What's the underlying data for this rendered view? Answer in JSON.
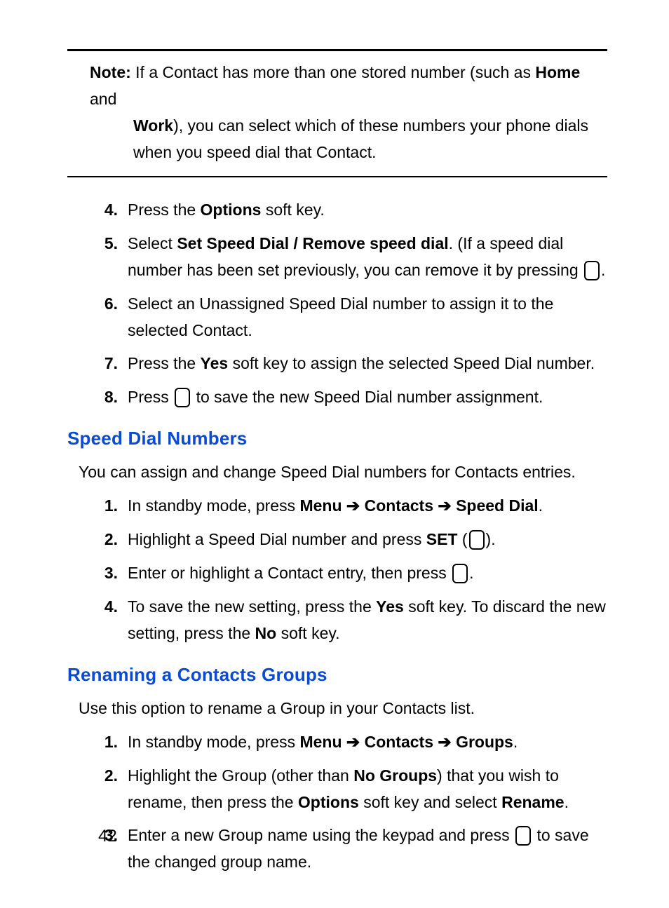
{
  "note": {
    "label": "Note:",
    "line1_pre": "If a Contact has more than one stored number (such as ",
    "home": "Home",
    "line1_mid": " and ",
    "work": "Work",
    "line2": "), you can select which of these numbers your phone dials when you speed dial that Contact."
  },
  "stepsA": [
    {
      "n": "4.",
      "pre": "Press the ",
      "b1": "Options",
      "post": " soft key."
    },
    {
      "n": "5.",
      "pre": "Select ",
      "b1": "Set Speed Dial / Remove speed dial",
      "mid": ". (If a speed dial number has been set previously, you can remove it by pressing ",
      "icon": true,
      "post": "."
    },
    {
      "n": "6.",
      "pre": "Select an Unassigned Speed Dial number to assign it to the selected Contact."
    },
    {
      "n": "7.",
      "pre": "Press the ",
      "b1": "Yes",
      "post": " soft key to assign the selected Speed Dial number."
    },
    {
      "n": "8.",
      "pre": "Press ",
      "icon": true,
      "post": " to save the new Speed Dial number assignment."
    }
  ],
  "section1": {
    "title": "Speed Dial Numbers",
    "intro": "You can assign and change Speed Dial numbers for Contacts entries.",
    "steps": [
      {
        "n": "1.",
        "pre": "In standby mode, press ",
        "path": [
          "Menu",
          "Contacts",
          "Speed Dial"
        ],
        "post": "."
      },
      {
        "n": "2.",
        "pre": "Highlight a Speed Dial number and press ",
        "b1": "SET",
        "mid": " (",
        "icon": true,
        "post": ")."
      },
      {
        "n": "3.",
        "pre": "Enter or highlight a Contact entry, then press ",
        "icon": true,
        "post": "."
      },
      {
        "n": "4.",
        "pre": "To save the new setting, press the ",
        "b1": "Yes",
        "mid": " soft key. To discard the new setting, press the ",
        "b2": "No",
        "post": " soft key."
      }
    ]
  },
  "section2": {
    "title": "Renaming a Contacts Groups",
    "intro": "Use this option to rename a Group in your Contacts list.",
    "steps": [
      {
        "n": "1.",
        "pre": "In standby mode, press ",
        "path": [
          "Menu",
          "Contacts",
          "Groups"
        ],
        "post": "."
      },
      {
        "n": "2.",
        "pre": "Highlight the Group (other than ",
        "b1": "No Groups",
        "mid": ") that you wish to rename, then press the ",
        "b2": "Options",
        "mid2": " soft key and select ",
        "b3": "Rename",
        "post": "."
      },
      {
        "n": "3.",
        "pre": "Enter a new Group name using the keypad and press ",
        "icon": true,
        "post": " to save the changed group name."
      }
    ]
  },
  "arrow": "➔",
  "pageNumber": "42"
}
